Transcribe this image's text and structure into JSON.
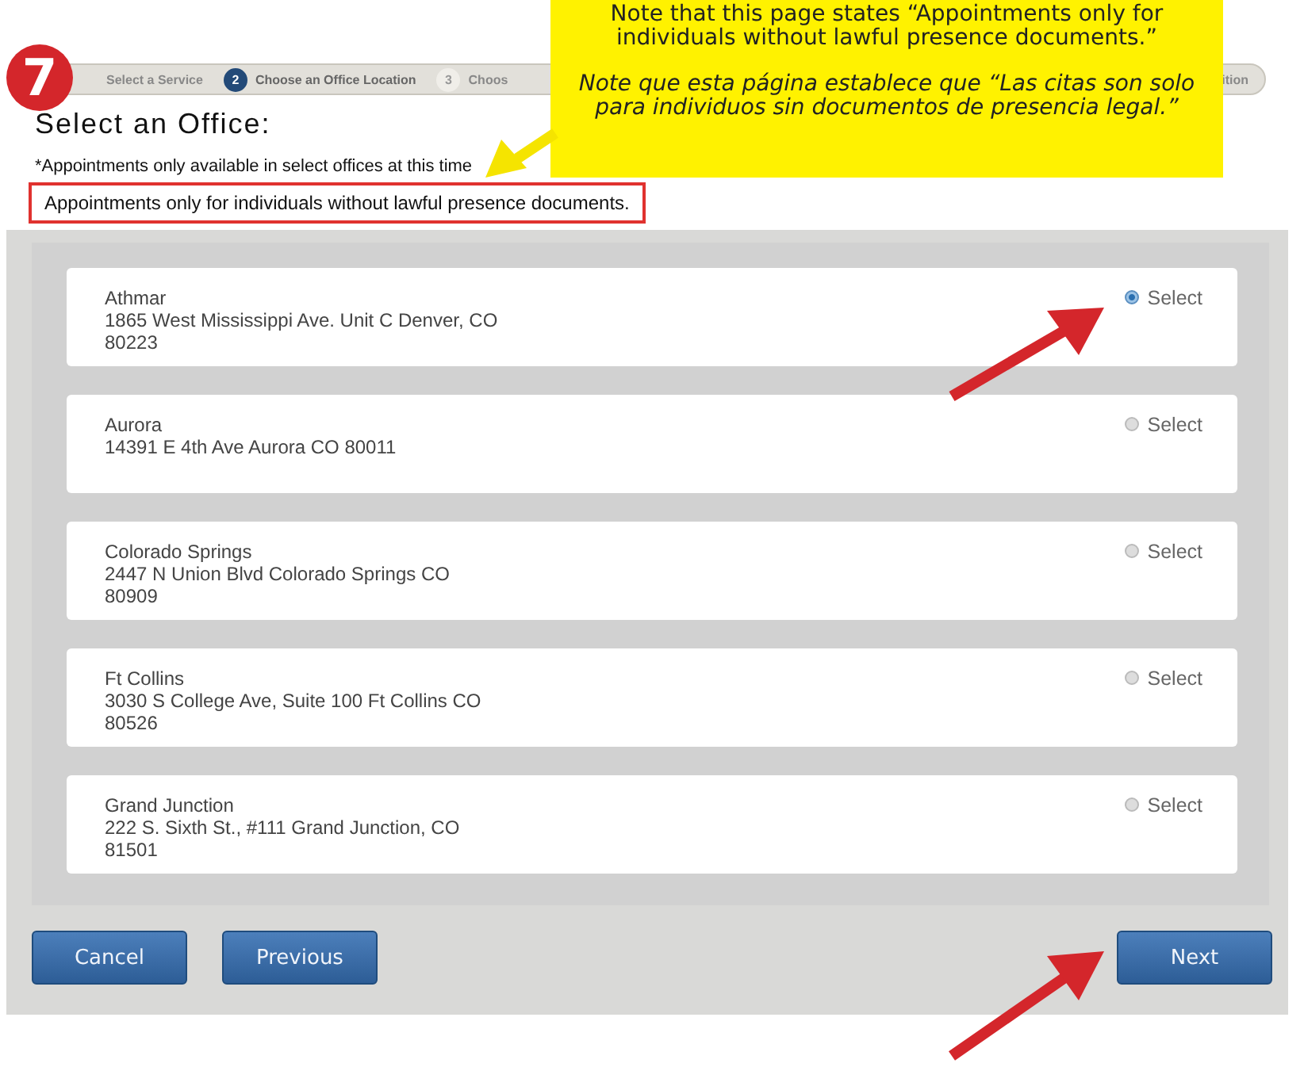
{
  "step_badge": "7",
  "callout": {
    "note_en": "Note that this page states “Appointments only for individuals without lawful presence documents.”",
    "note_es": "Note que esta página establece que “Las citas son solo para individuos sin documentos de presencia legal.”"
  },
  "steps": [
    {
      "label": "Select a Service",
      "selected": false
    },
    {
      "number": "2",
      "label": "Choose an Office Location",
      "selected": true
    },
    {
      "number": "3",
      "label": "Choos",
      "selected": false
    }
  ],
  "steps_tail": "ition",
  "title": "Select an Office:",
  "subtitle": "*Appointments only available in select offices at this time",
  "notice": "Appointments only for individuals without lawful presence documents.",
  "offices": [
    {
      "name": "Athmar",
      "address": [
        "1865 West Mississippi Ave. Unit C Denver, CO",
        "80223"
      ],
      "select_label": "Select",
      "selected": true
    },
    {
      "name": "Aurora",
      "address": [
        "14391 E 4th Ave Aurora CO 80011"
      ],
      "select_label": "Select",
      "selected": false
    },
    {
      "name": "Colorado Springs",
      "address": [
        "2447 N Union Blvd Colorado Springs CO",
        "80909"
      ],
      "select_label": "Select",
      "selected": false
    },
    {
      "name": "Ft Collins",
      "address": [
        "3030 S College Ave, Suite 100 Ft Collins CO",
        "80526"
      ],
      "select_label": "Select",
      "selected": false
    },
    {
      "name": "Grand Junction",
      "address": [
        "222 S. Sixth St., #111 Grand Junction, CO",
        "81501"
      ],
      "select_label": "Select",
      "selected": false
    }
  ],
  "buttons": {
    "cancel": "Cancel",
    "previous": "Previous",
    "next": "Next"
  }
}
